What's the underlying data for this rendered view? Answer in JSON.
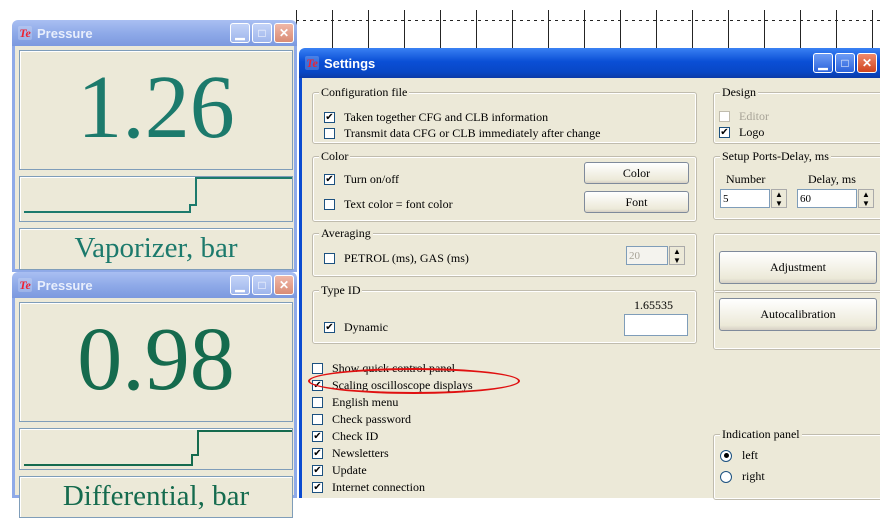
{
  "pressure_top": {
    "title": "Pressure",
    "value": "1.26",
    "label": "Vaporizer, bar"
  },
  "pressure_bottom": {
    "title": "Pressure",
    "value": "0.98",
    "label": "Differential, bar"
  },
  "settings": {
    "title": "Settings",
    "config_file": {
      "legend": "Configuration file",
      "option1": "Taken together CFG and CLB information",
      "option2": "Transmit data CFG or CLB immediately after change"
    },
    "design": {
      "legend": "Design",
      "editor": "Editor",
      "logo": "Logo"
    },
    "color": {
      "legend": "Color",
      "turn_on_off": "Turn on/off",
      "text_color": "Text color = font color",
      "color_button": "Color",
      "font_button": "Font"
    },
    "ports": {
      "legend": "Setup Ports-Delay, ms",
      "number_label": "Number",
      "delay_label": "Delay, ms",
      "number_value": "5",
      "delay_value": "60"
    },
    "averaging": {
      "legend": "Averaging",
      "option": "PETROL (ms), GAS (ms)",
      "value": "20"
    },
    "adjustment_button": "Adjustment",
    "type_id": {
      "legend": "Type ID",
      "version": "1.65535",
      "dynamic": "Dynamic"
    },
    "autocalibration_button": "Autocalibration",
    "options": [
      {
        "label": "Show quick control panel",
        "checked": false
      },
      {
        "label": "Scaling oscilloscope displays",
        "checked": true
      },
      {
        "label": "English menu",
        "checked": false
      },
      {
        "label": "Check password",
        "checked": false
      },
      {
        "label": "Check ID",
        "checked": true
      },
      {
        "label": "Newsletters",
        "checked": true
      },
      {
        "label": "Update",
        "checked": true
      },
      {
        "label": "Internet connection",
        "checked": true
      }
    ],
    "indication_panel": {
      "legend": "Indication panel",
      "left": "left",
      "right": "right"
    }
  },
  "colors": {
    "digit": "#1c7a6c",
    "highlight": "#e01010"
  }
}
